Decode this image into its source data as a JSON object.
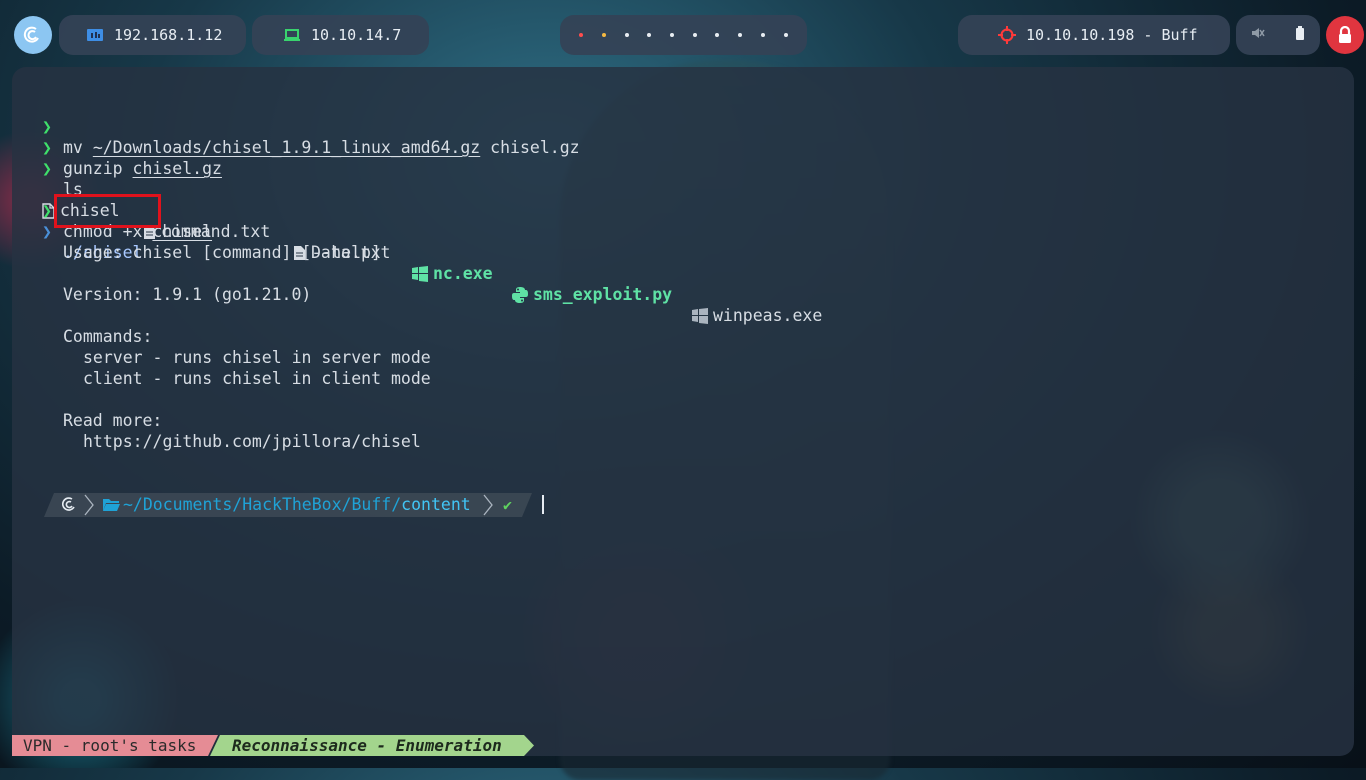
{
  "topbar": {
    "local_ip": "192.168.1.12",
    "vpn_ip": "10.10.14.7",
    "workspace_dots": [
      {
        "color": "#ff4d4d"
      },
      {
        "color": "#f5b942"
      },
      {
        "color": "#e8edf2"
      },
      {
        "color": "#e8edf2"
      },
      {
        "color": "#e8edf2"
      },
      {
        "color": "#e8edf2"
      },
      {
        "color": "#e8edf2"
      },
      {
        "color": "#e8edf2"
      },
      {
        "color": "#e8edf2"
      },
      {
        "color": "#e8edf2"
      }
    ],
    "target": "10.10.10.198 - Buff",
    "icons": {
      "logo": "debian-swirl-icon",
      "local": "network-folder-icon",
      "vpn": "laptop-icon",
      "target": "crosshair-icon",
      "volume": "mute-icon",
      "battery": "battery-icon",
      "lock": "lock-icon"
    }
  },
  "terminal": {
    "prompt_symbol": "❯",
    "history": [
      {
        "cmd": "mv",
        "arg1": "~/Downloads/chisel_1.9.1_linux_amd64.gz",
        "arg2": "chisel.gz"
      },
      {
        "cmd": "gunzip",
        "arg1": "chisel.gz"
      },
      {
        "cmd": "ls"
      },
      {
        "cmd": "chmod",
        "arg1": "+x",
        "arg2": "chisel"
      },
      {
        "cmd": "./chisel"
      }
    ],
    "ls_output": [
      {
        "name": "chisel",
        "icon": "file-icon"
      },
      {
        "name": "command.txt",
        "icon": "text-file-icon"
      },
      {
        "name": "Data.txt",
        "icon": "text-file-icon"
      },
      {
        "name": "nc.exe",
        "icon": "windows-icon"
      },
      {
        "name": "sms_exploit.py",
        "icon": "python-icon"
      },
      {
        "name": "winpeas.exe",
        "icon": "windows-icon"
      }
    ],
    "output": {
      "usage": "Usage: chisel [command] [--help]",
      "version": "Version: 1.9.1 (go1.21.0)",
      "commands_header": "Commands:",
      "server_line": "server - runs chisel in server mode",
      "client_line": "client - runs chisel in client mode",
      "read_more": "Read more:",
      "url": "https://github.com/jpillora/chisel"
    },
    "prompt": {
      "path_prefix": "~/Documents/HackTheBox/Buff/",
      "path_current": "content",
      "status": "✔"
    }
  },
  "statusbar": {
    "vpn_tasks": "VPN - root's tasks",
    "phase": "Reconnaissance - Enumeration"
  },
  "colors": {
    "prompt_green": "#3fe06b",
    "highlight": "#e0121c",
    "path_blue": "#1fa2d6",
    "status_pink": "#e58c95",
    "status_green": "#a3d58d"
  }
}
